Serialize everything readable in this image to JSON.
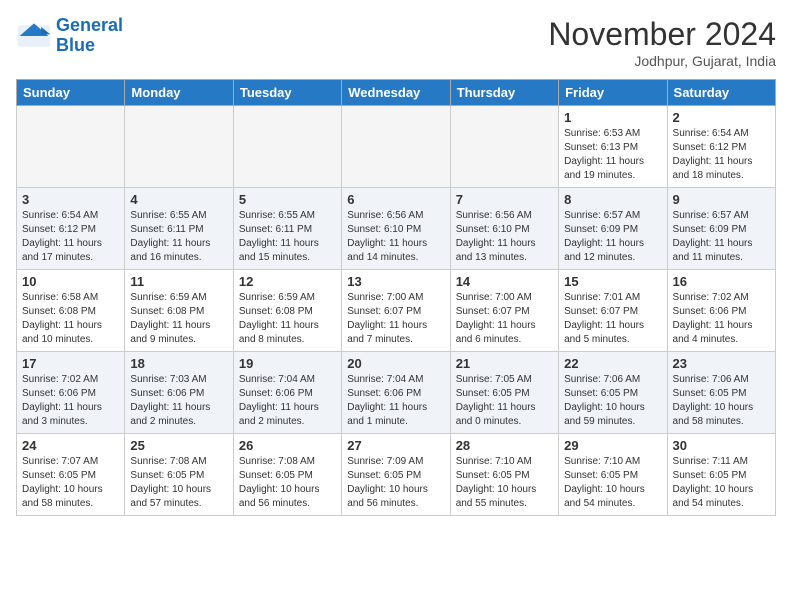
{
  "header": {
    "logo_line1": "General",
    "logo_line2": "Blue",
    "month": "November 2024",
    "location": "Jodhpur, Gujarat, India"
  },
  "weekdays": [
    "Sunday",
    "Monday",
    "Tuesday",
    "Wednesday",
    "Thursday",
    "Friday",
    "Saturday"
  ],
  "weeks": [
    [
      {
        "day": "",
        "info": ""
      },
      {
        "day": "",
        "info": ""
      },
      {
        "day": "",
        "info": ""
      },
      {
        "day": "",
        "info": ""
      },
      {
        "day": "",
        "info": ""
      },
      {
        "day": "1",
        "info": "Sunrise: 6:53 AM\nSunset: 6:13 PM\nDaylight: 11 hours\nand 19 minutes."
      },
      {
        "day": "2",
        "info": "Sunrise: 6:54 AM\nSunset: 6:12 PM\nDaylight: 11 hours\nand 18 minutes."
      }
    ],
    [
      {
        "day": "3",
        "info": "Sunrise: 6:54 AM\nSunset: 6:12 PM\nDaylight: 11 hours\nand 17 minutes."
      },
      {
        "day": "4",
        "info": "Sunrise: 6:55 AM\nSunset: 6:11 PM\nDaylight: 11 hours\nand 16 minutes."
      },
      {
        "day": "5",
        "info": "Sunrise: 6:55 AM\nSunset: 6:11 PM\nDaylight: 11 hours\nand 15 minutes."
      },
      {
        "day": "6",
        "info": "Sunrise: 6:56 AM\nSunset: 6:10 PM\nDaylight: 11 hours\nand 14 minutes."
      },
      {
        "day": "7",
        "info": "Sunrise: 6:56 AM\nSunset: 6:10 PM\nDaylight: 11 hours\nand 13 minutes."
      },
      {
        "day": "8",
        "info": "Sunrise: 6:57 AM\nSunset: 6:09 PM\nDaylight: 11 hours\nand 12 minutes."
      },
      {
        "day": "9",
        "info": "Sunrise: 6:57 AM\nSunset: 6:09 PM\nDaylight: 11 hours\nand 11 minutes."
      }
    ],
    [
      {
        "day": "10",
        "info": "Sunrise: 6:58 AM\nSunset: 6:08 PM\nDaylight: 11 hours\nand 10 minutes."
      },
      {
        "day": "11",
        "info": "Sunrise: 6:59 AM\nSunset: 6:08 PM\nDaylight: 11 hours\nand 9 minutes."
      },
      {
        "day": "12",
        "info": "Sunrise: 6:59 AM\nSunset: 6:08 PM\nDaylight: 11 hours\nand 8 minutes."
      },
      {
        "day": "13",
        "info": "Sunrise: 7:00 AM\nSunset: 6:07 PM\nDaylight: 11 hours\nand 7 minutes."
      },
      {
        "day": "14",
        "info": "Sunrise: 7:00 AM\nSunset: 6:07 PM\nDaylight: 11 hours\nand 6 minutes."
      },
      {
        "day": "15",
        "info": "Sunrise: 7:01 AM\nSunset: 6:07 PM\nDaylight: 11 hours\nand 5 minutes."
      },
      {
        "day": "16",
        "info": "Sunrise: 7:02 AM\nSunset: 6:06 PM\nDaylight: 11 hours\nand 4 minutes."
      }
    ],
    [
      {
        "day": "17",
        "info": "Sunrise: 7:02 AM\nSunset: 6:06 PM\nDaylight: 11 hours\nand 3 minutes."
      },
      {
        "day": "18",
        "info": "Sunrise: 7:03 AM\nSunset: 6:06 PM\nDaylight: 11 hours\nand 2 minutes."
      },
      {
        "day": "19",
        "info": "Sunrise: 7:04 AM\nSunset: 6:06 PM\nDaylight: 11 hours\nand 2 minutes."
      },
      {
        "day": "20",
        "info": "Sunrise: 7:04 AM\nSunset: 6:06 PM\nDaylight: 11 hours\nand 1 minute."
      },
      {
        "day": "21",
        "info": "Sunrise: 7:05 AM\nSunset: 6:05 PM\nDaylight: 11 hours\nand 0 minutes."
      },
      {
        "day": "22",
        "info": "Sunrise: 7:06 AM\nSunset: 6:05 PM\nDaylight: 10 hours\nand 59 minutes."
      },
      {
        "day": "23",
        "info": "Sunrise: 7:06 AM\nSunset: 6:05 PM\nDaylight: 10 hours\nand 58 minutes."
      }
    ],
    [
      {
        "day": "24",
        "info": "Sunrise: 7:07 AM\nSunset: 6:05 PM\nDaylight: 10 hours\nand 58 minutes."
      },
      {
        "day": "25",
        "info": "Sunrise: 7:08 AM\nSunset: 6:05 PM\nDaylight: 10 hours\nand 57 minutes."
      },
      {
        "day": "26",
        "info": "Sunrise: 7:08 AM\nSunset: 6:05 PM\nDaylight: 10 hours\nand 56 minutes."
      },
      {
        "day": "27",
        "info": "Sunrise: 7:09 AM\nSunset: 6:05 PM\nDaylight: 10 hours\nand 56 minutes."
      },
      {
        "day": "28",
        "info": "Sunrise: 7:10 AM\nSunset: 6:05 PM\nDaylight: 10 hours\nand 55 minutes."
      },
      {
        "day": "29",
        "info": "Sunrise: 7:10 AM\nSunset: 6:05 PM\nDaylight: 10 hours\nand 54 minutes."
      },
      {
        "day": "30",
        "info": "Sunrise: 7:11 AM\nSunset: 6:05 PM\nDaylight: 10 hours\nand 54 minutes."
      }
    ]
  ]
}
